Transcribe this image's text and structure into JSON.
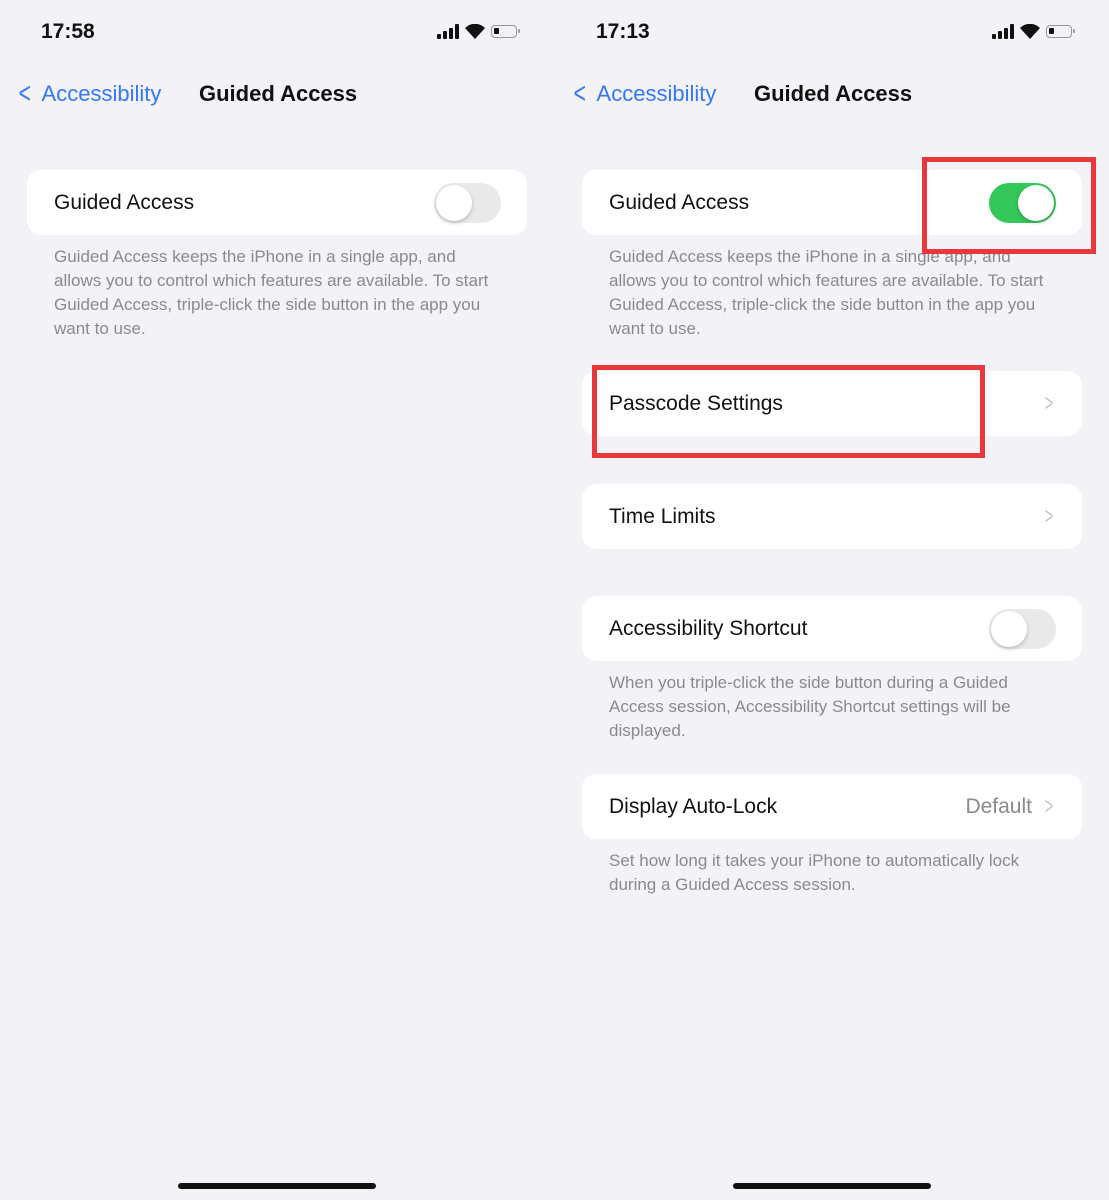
{
  "left": {
    "time": "17:58",
    "nav": {
      "back_label": "Accessibility",
      "title": "Guided Access"
    },
    "guided_access": {
      "label": "Guided Access",
      "on": false,
      "footer": "Guided Access keeps the iPhone in a single app, and allows you to control which features are available. To start Guided Access, triple-click the side button in the app you want to use."
    }
  },
  "right": {
    "time": "17:13",
    "nav": {
      "back_label": "Accessibility",
      "title": "Guided Access"
    },
    "guided_access": {
      "label": "Guided Access",
      "on": true,
      "footer": "Guided Access keeps the iPhone in a single app, and allows you to control which features are available. To start Guided Access, triple-click the side button in the app you want to use."
    },
    "passcode_settings": {
      "label": "Passcode Settings"
    },
    "time_limits": {
      "label": "Time Limits"
    },
    "accessibility_shortcut": {
      "label": "Accessibility Shortcut",
      "on": false,
      "footer": "When you triple-click the side button during a Guided Access session, Accessibility Shortcut settings will be displayed."
    },
    "display_auto_lock": {
      "label": "Display Auto-Lock",
      "value": "Default",
      "footer": "Set how long it takes your iPhone to automatically lock during a Guided Access session."
    }
  },
  "colors": {
    "accent": "#3478f6",
    "toggle_on": "#34c759",
    "highlight": "#e8383b",
    "background": "#f2f2f7"
  },
  "icons": [
    "signal-icon",
    "wifi-icon",
    "battery-icon",
    "chevron-left-icon",
    "chevron-right-icon"
  ]
}
